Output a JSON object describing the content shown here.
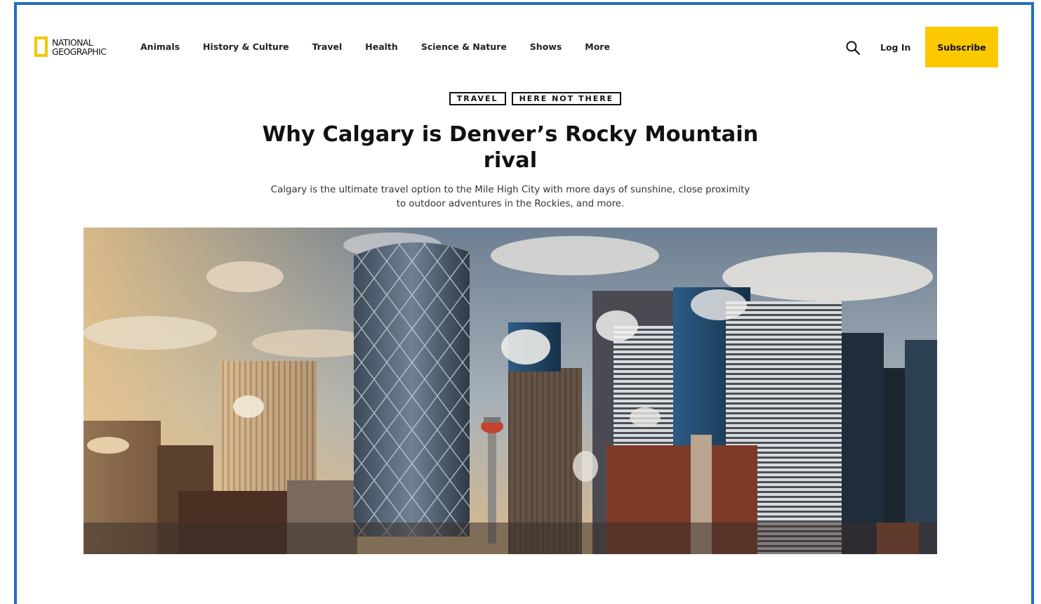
{
  "brand": {
    "logo_line1": "NATIONAL",
    "logo_line2": "GEOGRAPHIC",
    "accent_color": "#fcc800",
    "frame_color": "#1f6fc0"
  },
  "nav": {
    "items": [
      "Animals",
      "History & Culture",
      "Travel",
      "Health",
      "Science & Nature",
      "Shows",
      "More"
    ],
    "search_icon": "search-icon",
    "login_label": "Log In",
    "subscribe_label": "Subscribe"
  },
  "article": {
    "tags": [
      "TRAVEL",
      "HERE NOT THERE"
    ],
    "headline": "Why Calgary is Denver’s Rocky Mountain rival",
    "dek": "Calgary is the ultimate travel option to the Mile High City with more days of sunshine, close proximity to outdoor adventures in the Rockies, and more."
  }
}
